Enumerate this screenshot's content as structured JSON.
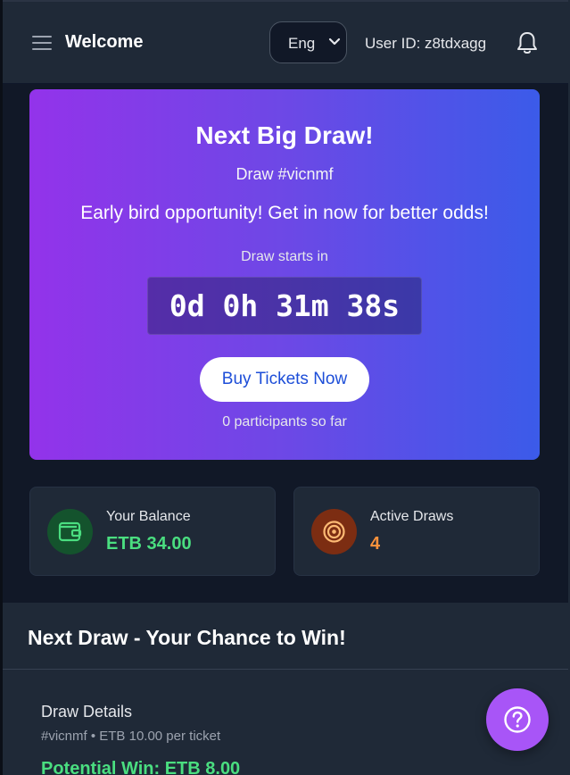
{
  "header": {
    "title": "Welcome",
    "language": "Eng",
    "user_id": "User ID: z8tdxagg"
  },
  "hero": {
    "title": "Next Big Draw!",
    "draw_id": "Draw #vicnmf",
    "message": "Early bird opportunity! Get in now for better odds!",
    "starts_label": "Draw starts in",
    "countdown": "0d 0h 31m 38s",
    "buy_label": "Buy Tickets Now",
    "participants": "0 participants so far"
  },
  "stats": {
    "balance": {
      "label": "Your Balance",
      "value": "ETB 34.00",
      "icon": "wallet-icon",
      "color": "#4ade80"
    },
    "draws": {
      "label": "Active Draws",
      "value": "4",
      "icon": "target-icon",
      "color": "#fb923c"
    }
  },
  "next_draw": {
    "title": "Next Draw - Your Chance to Win!",
    "details_title": "Draw Details",
    "details_sub": "#vicnmf • ETB 10.00 per ticket",
    "potential_win": "Potential Win: ETB 8.00"
  },
  "help": {
    "icon": "question-icon"
  },
  "colors": {
    "background": "#111827",
    "panel": "#1f2937",
    "hero_gradient_start": "#9333ea",
    "hero_gradient_end": "#3b5be9",
    "accent_purple": "#a855f7",
    "button_text": "#1d4ed8"
  }
}
